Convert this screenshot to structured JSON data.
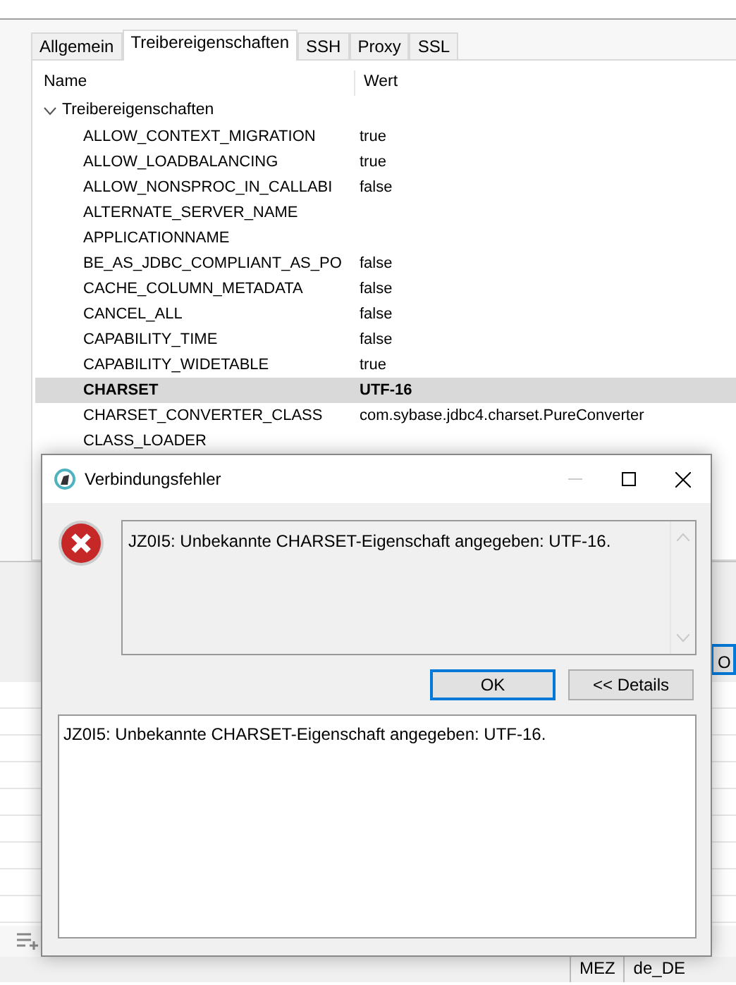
{
  "settings_window": {
    "tabs": [
      {
        "label": "Allgemein",
        "selected": false
      },
      {
        "label": "Treibereigenschaften",
        "selected": true
      },
      {
        "label": "SSH",
        "selected": false
      },
      {
        "label": "Proxy",
        "selected": false
      },
      {
        "label": "SSL",
        "selected": false
      }
    ],
    "table": {
      "columns": [
        "Name",
        "Wert"
      ],
      "groups": [
        {
          "label": "Treibereigenschaften",
          "expanded": true,
          "children": [
            {
              "name": "ALLOW_CONTEXT_MIGRATION",
              "value": "true",
              "selected": false
            },
            {
              "name": "ALLOW_LOADBALANCING",
              "value": "true",
              "selected": false
            },
            {
              "name": "ALLOW_NONSPROC_IN_CALLABI",
              "value": "false",
              "selected": false
            },
            {
              "name": "ALTERNATE_SERVER_NAME",
              "selected": false
            },
            {
              "name": "APPLICATIONNAME",
              "selected": false
            },
            {
              "name": "BE_AS_JDBC_COMPLIANT_AS_PO",
              "value": "false",
              "selected": false
            },
            {
              "name": "CACHE_COLUMN_METADATA",
              "value": "false",
              "selected": false
            },
            {
              "name": "CANCEL_ALL",
              "value": "false",
              "selected": false
            },
            {
              "name": "CAPABILITY_TIME",
              "value": "false",
              "selected": false
            },
            {
              "name": "CAPABILITY_WIDETABLE",
              "value": "true",
              "selected": false
            },
            {
              "name": "CHARSET",
              "value": "UTF-16",
              "selected": true
            },
            {
              "name": "CHARSET_CONVERTER_CLASS",
              "value": "com.sybase.jdbc4.charset.PureConverter",
              "selected": false
            },
            {
              "name": "CLASS_LOADER",
              "selected": false
            }
          ]
        }
      ]
    },
    "side_button": "O",
    "status_bar": [
      "MEZ",
      "de_DE"
    ]
  },
  "dialog": {
    "title": "Verbindungsfehler",
    "message": "JZ0I5: Unbekannte CHARSET-Eigenschaft angegeben: UTF-16.",
    "buttons": [
      {
        "label": "OK",
        "default": true
      },
      {
        "label": "<< Details",
        "default": false
      }
    ],
    "details": "JZ0I5: Unbekannte CHARSET-Eigenschaft angegeben: UTF-16."
  }
}
